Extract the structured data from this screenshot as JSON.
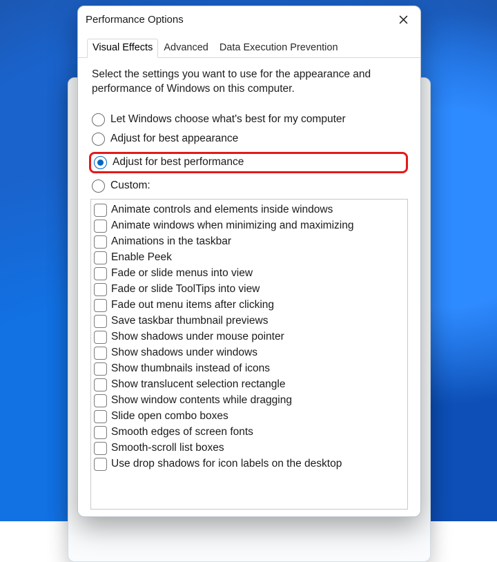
{
  "window": {
    "title": "Performance Options"
  },
  "tabs": [
    {
      "label": "Visual Effects",
      "active": true
    },
    {
      "label": "Advanced",
      "active": false
    },
    {
      "label": "Data Execution Prevention",
      "active": false
    }
  ],
  "intro": "Select the settings you want to use for the appearance and performance of Windows on this computer.",
  "radios": [
    {
      "label": "Let Windows choose what's best for my computer",
      "checked": false,
      "highlight": false
    },
    {
      "label": "Adjust for best appearance",
      "checked": false,
      "highlight": false
    },
    {
      "label": "Adjust for best performance",
      "checked": true,
      "highlight": true
    },
    {
      "label": "Custom:",
      "checked": false,
      "highlight": false
    }
  ],
  "effects": [
    "Animate controls and elements inside windows",
    "Animate windows when minimizing and maximizing",
    "Animations in the taskbar",
    "Enable Peek",
    "Fade or slide menus into view",
    "Fade or slide ToolTips into view",
    "Fade out menu items after clicking",
    "Save taskbar thumbnail previews",
    "Show shadows under mouse pointer",
    "Show shadows under windows",
    "Show thumbnails instead of icons",
    "Show translucent selection rectangle",
    "Show window contents while dragging",
    "Slide open combo boxes",
    "Smooth edges of screen fonts",
    "Smooth-scroll list boxes",
    "Use drop shadows for icon labels on the desktop"
  ]
}
